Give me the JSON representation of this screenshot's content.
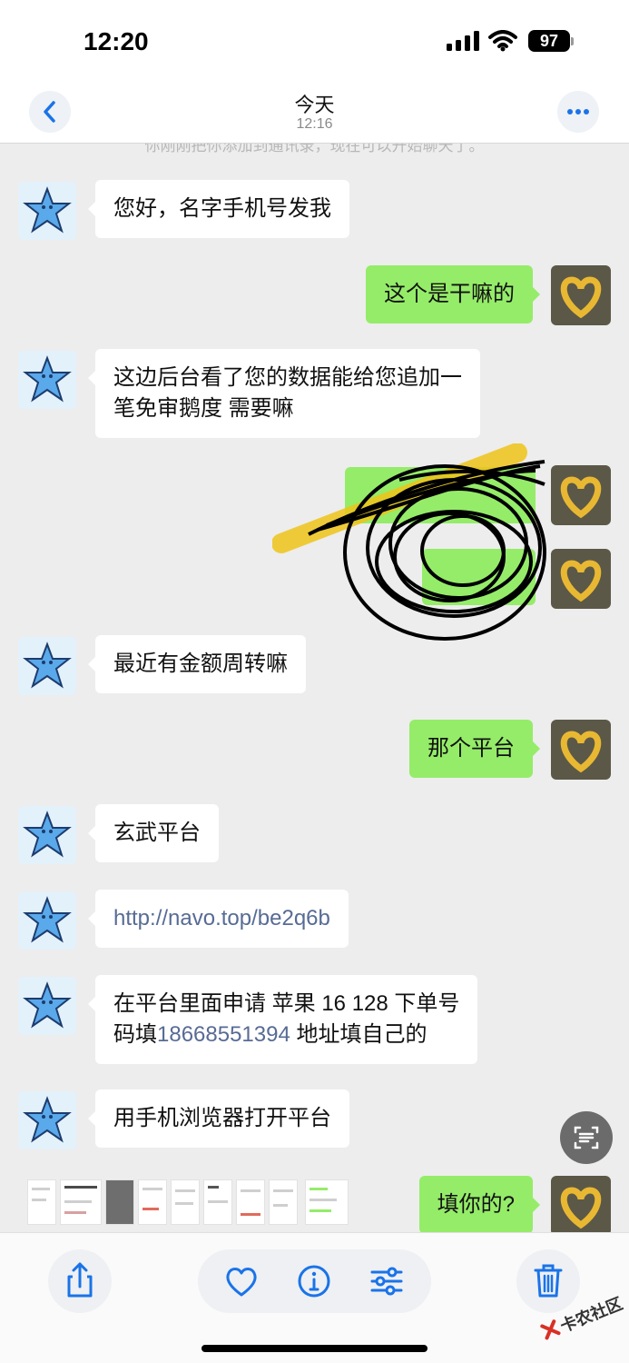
{
  "status_bar": {
    "time": "12:20",
    "battery": "97"
  },
  "nav": {
    "title": "今天",
    "subtitle": "12:16"
  },
  "system_notice": "你刚刚把你添加到通讯录，现在可以开始聊天了。",
  "messages": [
    {
      "side": "left",
      "text": "您好，名字手机号发我"
    },
    {
      "side": "right",
      "text": "这个是干嘛的"
    },
    {
      "side": "left",
      "line1": "这边后台看了您的数据能给您追加一",
      "line2": "笔免审鹅度 需要嘛"
    },
    {
      "side": "left",
      "text": "最近有金额周转嘛"
    },
    {
      "side": "right",
      "text": "那个平台"
    },
    {
      "side": "left",
      "text": "玄武平台"
    },
    {
      "side": "left",
      "text": "http://navo.top/be2q6b",
      "is_link": true
    },
    {
      "side": "left",
      "line1": "在平台里面申请 苹果 16 128  下单号",
      "line2_pre": "码填",
      "line2_phone": "18668551394",
      "line2_post": " 地址填自己的"
    },
    {
      "side": "left",
      "text": "用手机浏览器打开平台"
    },
    {
      "side": "right",
      "text": "填你的?"
    }
  ],
  "watermark": "卡农社区",
  "icons": {
    "back": "chevron-left-icon",
    "more": "ellipsis-icon",
    "scan": "scan-text-icon",
    "share": "share-icon",
    "favorite": "heart-icon",
    "info": "info-icon",
    "adjust": "sliders-icon",
    "delete": "trash-icon"
  },
  "colors": {
    "accent": "#1a73e8",
    "bubble_self": "#95ec69",
    "bubble_other": "#ffffff",
    "chat_bg": "#ededed",
    "link": "#576b95"
  }
}
